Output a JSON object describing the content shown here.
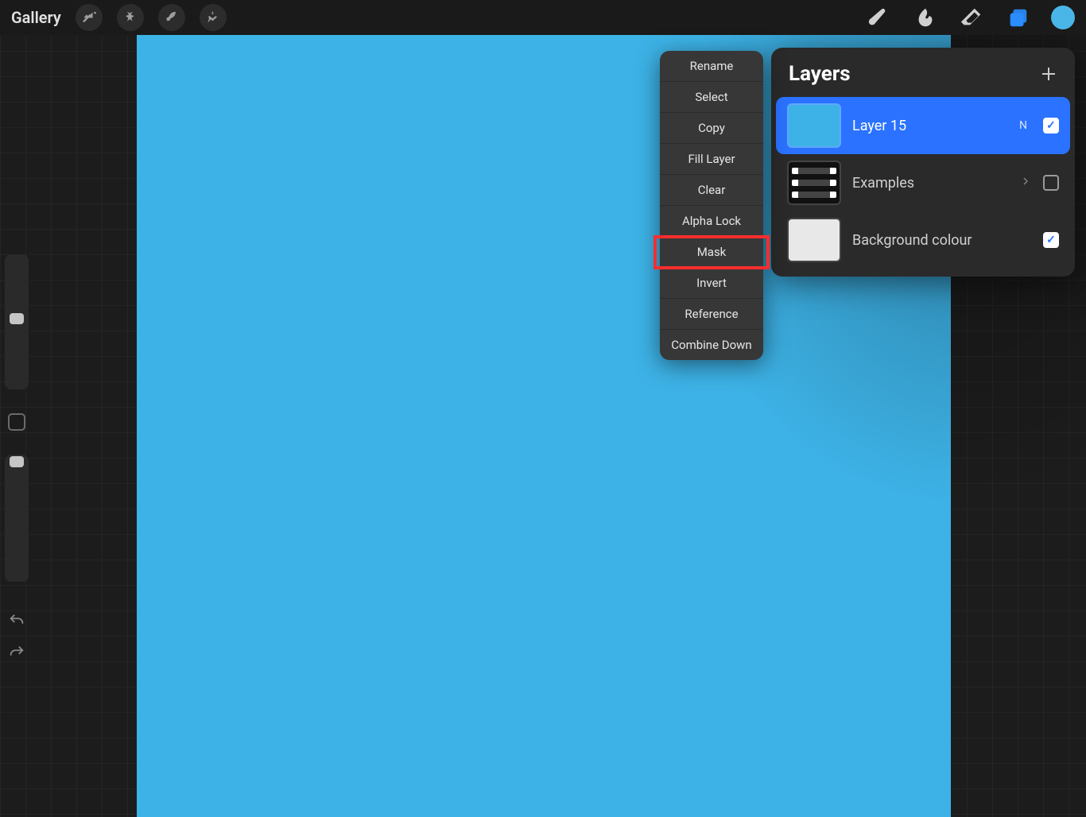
{
  "topbar": {
    "gallery": "Gallery"
  },
  "layers_panel": {
    "title": "Layers",
    "rows": [
      {
        "name": "Layer 15",
        "blend": "N",
        "visible": true,
        "selected": true,
        "thumb": "blue"
      },
      {
        "name": "Examples",
        "blend": "",
        "visible": false,
        "selected": false,
        "thumb": "examples",
        "group": true
      },
      {
        "name": "Background colour",
        "blend": "",
        "visible": true,
        "selected": false,
        "thumb": "bg"
      }
    ]
  },
  "context_menu": {
    "items": [
      "Rename",
      "Select",
      "Copy",
      "Fill Layer",
      "Clear",
      "Alpha Lock",
      "Mask",
      "Invert",
      "Reference",
      "Combine Down"
    ],
    "highlighted": "Mask"
  },
  "colors": {
    "canvas": "#3db2e6",
    "accent": "#2a72ff",
    "current_color": "#4ab6e8"
  }
}
